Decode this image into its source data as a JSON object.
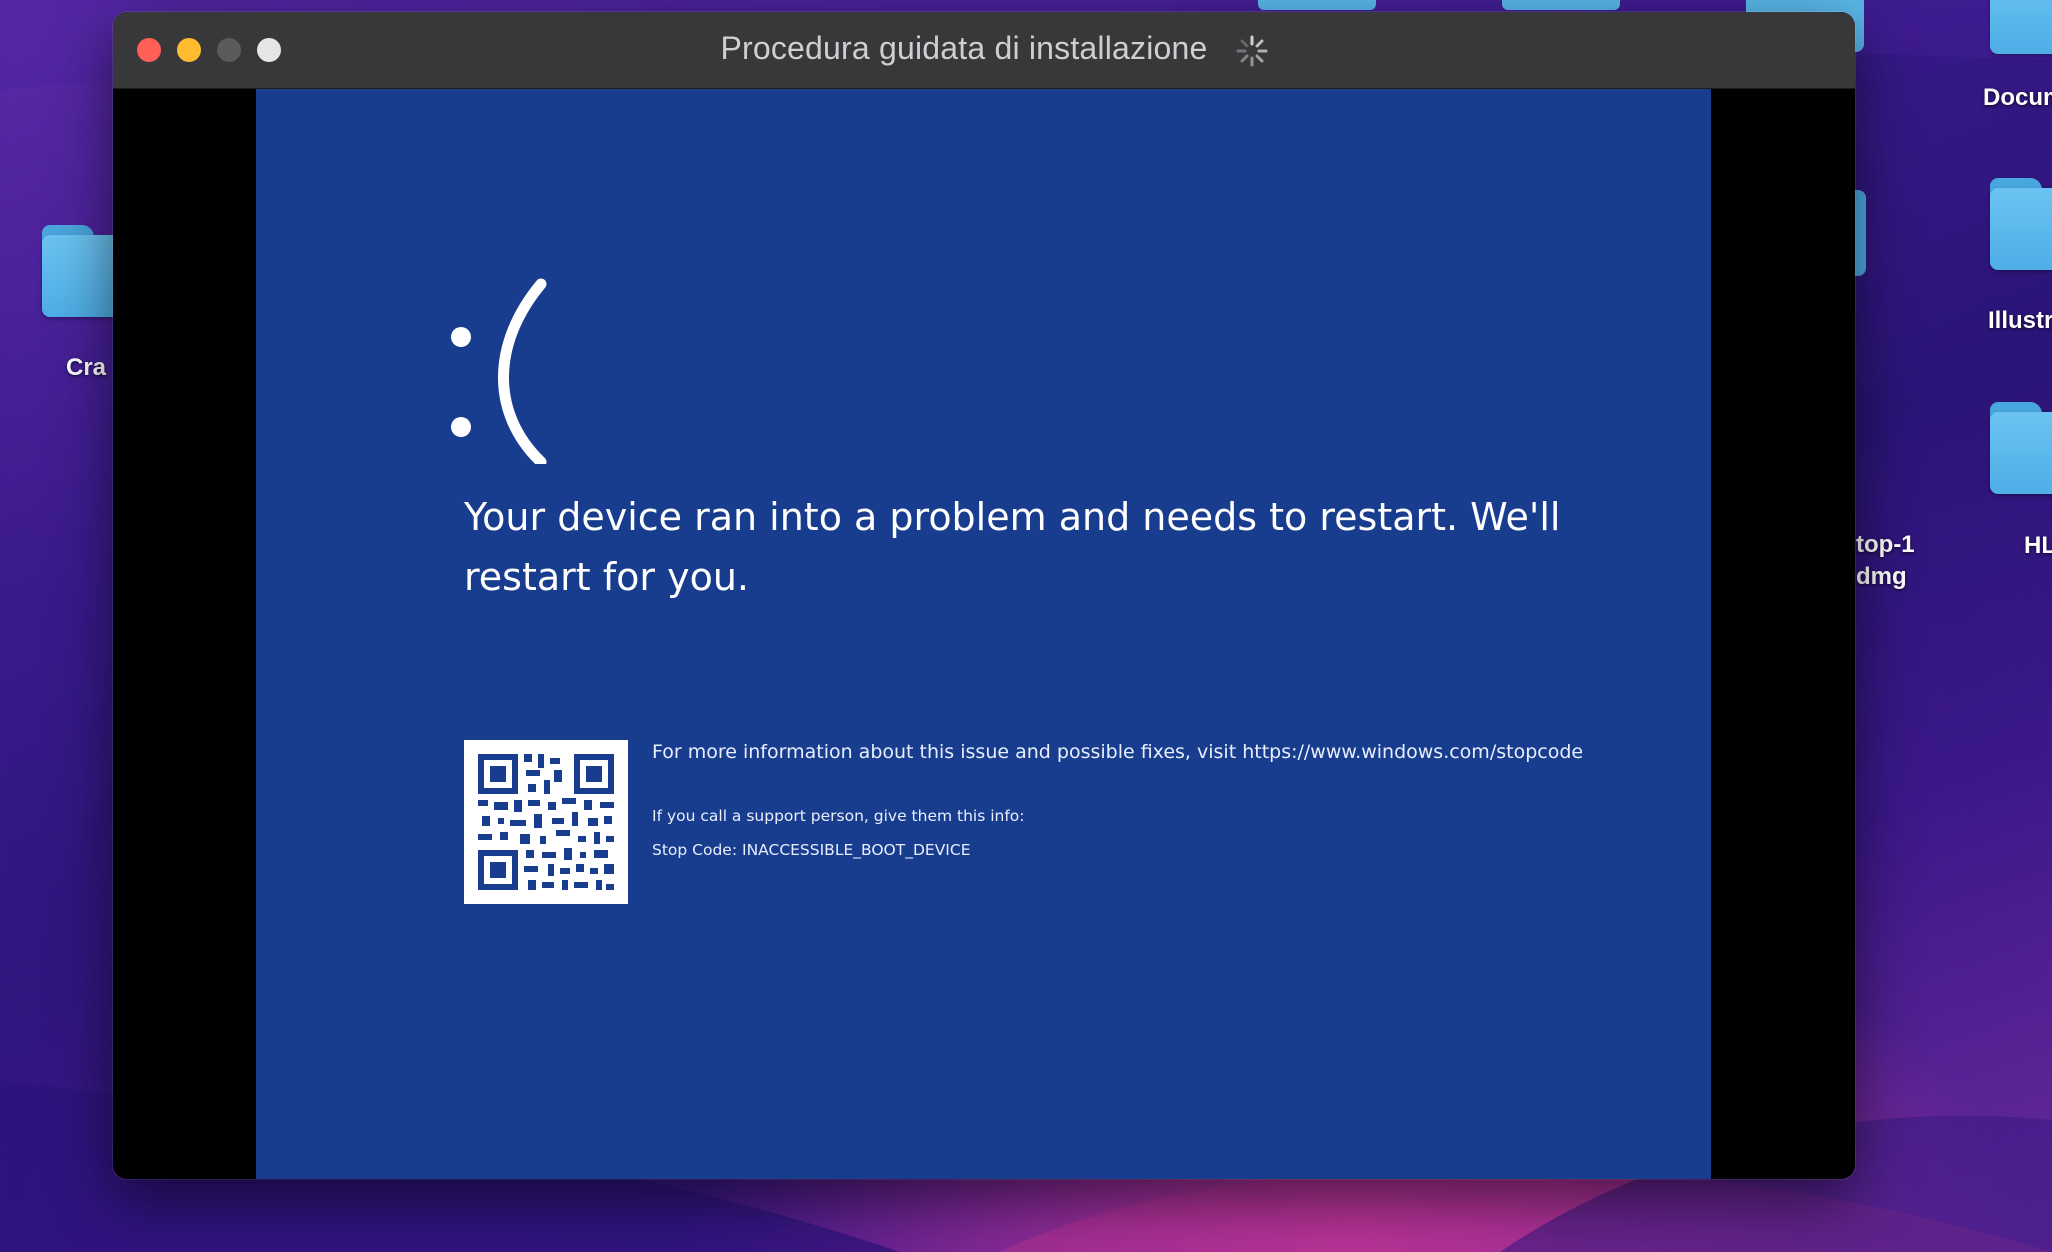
{
  "desktop": {
    "items": [
      {
        "label": "Cra"
      },
      {
        "label": "Docum"
      },
      {
        "label": "Illustr"
      },
      {
        "label": "HL"
      },
      {
        "label_line1": "top-1",
        "label_line2": "dmg"
      }
    ]
  },
  "window": {
    "title": "Procedura guidata di installazione",
    "spinner_icon": "activity-spinner-icon",
    "controls": [
      "close",
      "minimize",
      "zoom",
      "fullscreen"
    ]
  },
  "bsod": {
    "face": ":(",
    "message": "Your device ran into a problem and needs to restart. We'll restart for you.",
    "info": "For more information about this issue and possible fixes, visit https://www.windows.com/stopcode",
    "support": "If you call a support person, give them this info:",
    "stop_code": "Stop Code: INACCESSIBLE_BOOT_DEVICE",
    "background_color": "#183d8f"
  },
  "colors": {
    "close": "#fe5f57",
    "minimize": "#febc2e",
    "titlebar": "#38373a"
  }
}
